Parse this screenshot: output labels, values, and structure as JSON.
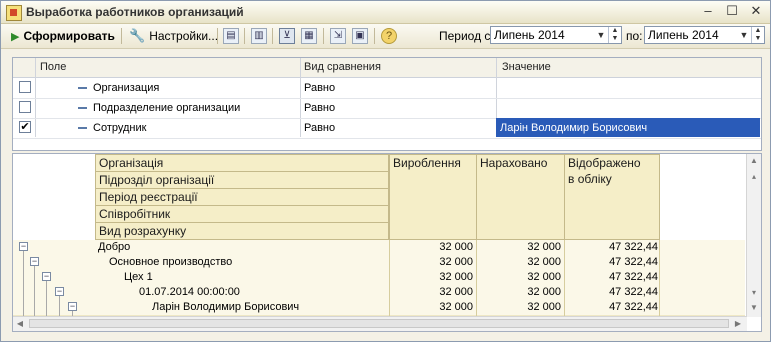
{
  "window": {
    "title": "Выработка работников организаций",
    "minimize": "–",
    "maximize": "☐",
    "close": "✕"
  },
  "toolbar": {
    "generate_label": "Сформировать",
    "settings_label": "Настройки...",
    "period_from_label": "Период с:",
    "period_from_value": "Липень 2014",
    "period_to_label": "по:",
    "period_to_value": "Липень 2014"
  },
  "filter": {
    "headers": [
      "Поле",
      "Вид сравнения",
      "Значение"
    ],
    "rows": [
      {
        "checked": false,
        "field": "Организация",
        "comparison": "Равно",
        "value": ""
      },
      {
        "checked": false,
        "field": "Подразделение организации",
        "comparison": "Равно",
        "value": ""
      },
      {
        "checked": true,
        "field": "Сотрудник",
        "comparison": "Равно",
        "value": "Ларін Володимир Борисович"
      }
    ]
  },
  "report": {
    "group_headers": [
      "Організація",
      "Підрозділ організації",
      "Період реєстрації",
      "Співробітник",
      "Вид розрахунку"
    ],
    "col_produced": "Вироблення",
    "col_accrued": "Нараховано",
    "col_reflected_line1": "Відображено",
    "col_reflected_line2": "в обліку",
    "rows": [
      {
        "name": "Добро",
        "produced": "32 000",
        "accrued": "32 000",
        "reflected": "47 322,44"
      },
      {
        "name": "Основное производство",
        "produced": "32 000",
        "accrued": "32 000",
        "reflected": "47 322,44"
      },
      {
        "name": "Цех 1",
        "produced": "32 000",
        "accrued": "32 000",
        "reflected": "47 322,44"
      },
      {
        "name": "01.07.2014 00:00:00",
        "produced": "32 000",
        "accrued": "32 000",
        "reflected": "47 322,44"
      },
      {
        "name": "Ларін Володимир Борисович",
        "produced": "32 000",
        "accrued": "32 000",
        "reflected": "47 322,44"
      }
    ]
  }
}
